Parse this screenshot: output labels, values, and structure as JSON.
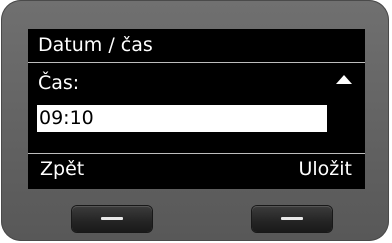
{
  "screen": {
    "title": "Datum / čas",
    "field_label": "Čas:",
    "field_value": "09:10",
    "scroll_indicator": "triangle-up-icon"
  },
  "softkeys": {
    "left_label": "Zpět",
    "right_label": "Uložit"
  },
  "colors": {
    "device_body": "#616161",
    "screen_bg": "#000000",
    "text": "#ffffff",
    "field_bg": "#ffffff",
    "key": "#262626"
  }
}
